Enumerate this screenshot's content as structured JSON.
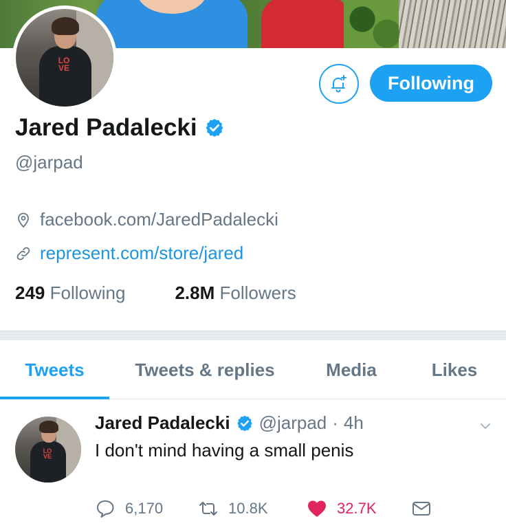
{
  "profile": {
    "name": "Jared Padalecki",
    "handle": "@jarpad",
    "location": "facebook.com/JaredPadalecki",
    "website": "represent.com/store/jared",
    "following_count": "249",
    "following_label": "Following",
    "followers_count": "2.8M",
    "followers_label": "Followers",
    "avatar_logo_text": "LO VE"
  },
  "buttons": {
    "follow_state": "Following",
    "notification_icon": "bell-plus-icon"
  },
  "tabs": [
    {
      "label": "Tweets",
      "active": true
    },
    {
      "label": "Tweets & replies",
      "active": false
    },
    {
      "label": "Media",
      "active": false
    },
    {
      "label": "Likes",
      "active": false
    }
  ],
  "tweet": {
    "name": "Jared Padalecki",
    "handle": "@jarpad",
    "separator": "·",
    "time": "4h",
    "text": "I don't mind having a small penis",
    "replies": "6,170",
    "retweets": "10.8K",
    "likes": "32.7K",
    "liked": true
  },
  "colors": {
    "accent": "#1da1f2",
    "link": "#1b95e0",
    "like": "#e0245e",
    "muted": "#657786",
    "text": "#14171a"
  }
}
